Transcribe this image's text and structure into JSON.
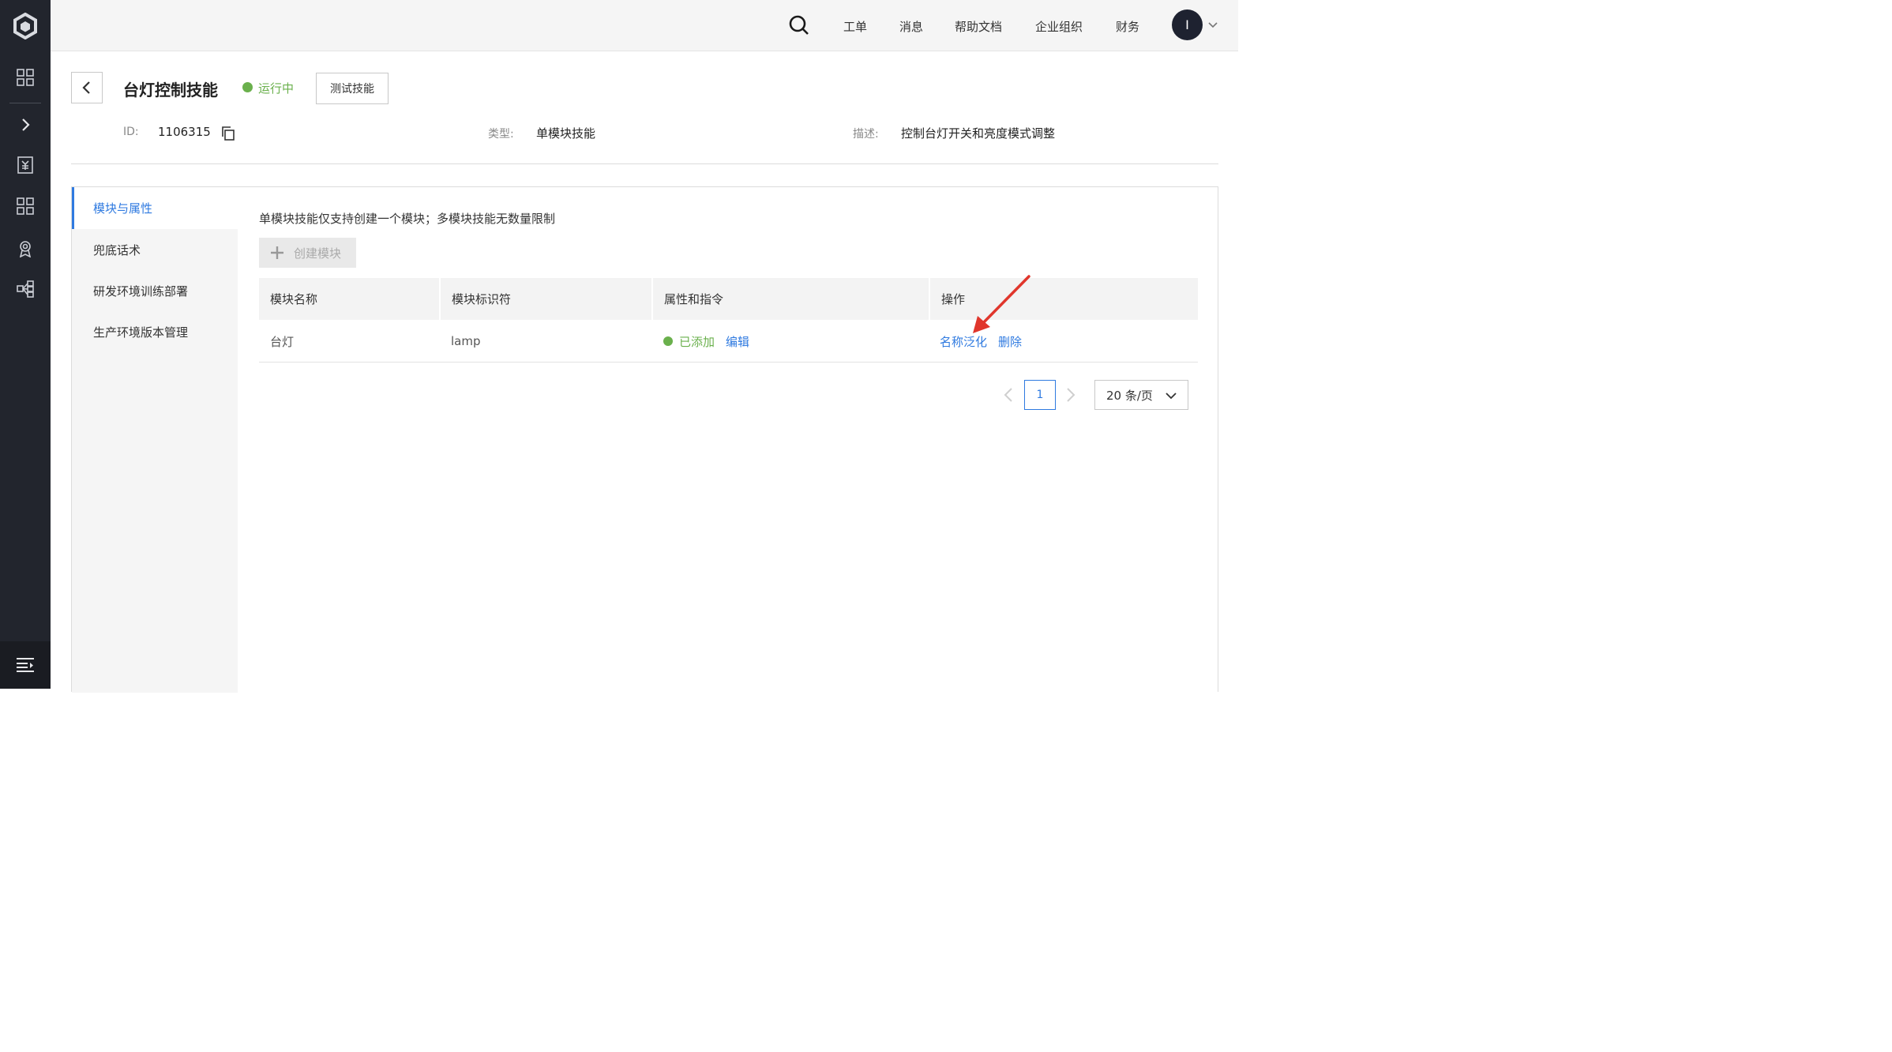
{
  "sidebar": {
    "icons": [
      "cube-logo-icon",
      "grid-icon",
      "chevron-right-icon",
      "receipt-icon",
      "grid-icon",
      "badge-icon",
      "flow-icon",
      "menu-collapse-icon"
    ]
  },
  "topbar": {
    "nav": [
      "工单",
      "消息",
      "帮助文档",
      "企业组织",
      "财务"
    ],
    "avatar_initial": "I"
  },
  "header": {
    "title": "台灯控制技能",
    "status": "运行中",
    "test_button": "测试技能",
    "status_color": "#6ab04c"
  },
  "meta": {
    "id_label": "ID:",
    "id_value": "1106315",
    "type_label": "类型:",
    "type_value": "单模块技能",
    "desc_label": "描述:",
    "desc_value": "控制台灯开关和亮度模式调整"
  },
  "tabs": [
    {
      "label": "模块与属性",
      "active": true
    },
    {
      "label": "兜底话术",
      "active": false
    },
    {
      "label": "研发环境训练部署",
      "active": false
    },
    {
      "label": "生产环境版本管理",
      "active": false
    }
  ],
  "content": {
    "hint": "单模块技能仅支持创建一个模块；多模块技能无数量限制",
    "create_button": "创建模块"
  },
  "table": {
    "columns": [
      "模块名称",
      "模块标识符",
      "属性和指令",
      "操作"
    ],
    "rows": [
      {
        "name": "台灯",
        "identifier": "lamp",
        "attr_status": "已添加",
        "attr_edit": "编辑",
        "action_generalize": "名称泛化",
        "action_delete": "删除"
      }
    ]
  },
  "pagination": {
    "current_page": "1",
    "page_size": "20 条/页"
  },
  "colors": {
    "accent": "#2f7ae0",
    "success": "#6ab04c",
    "sidebar_bg": "#22252d",
    "annotation": "#e0362c"
  }
}
